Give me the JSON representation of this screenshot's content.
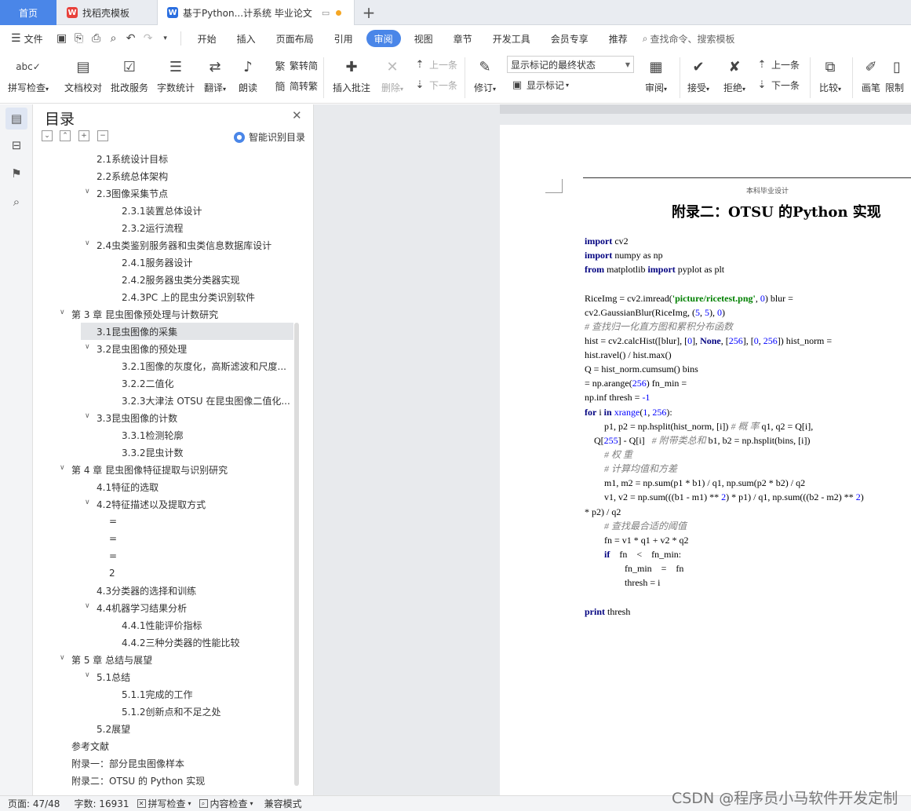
{
  "tabs": {
    "home": "首页",
    "templates": "找稻壳模板",
    "document": "基于Python...计系统 毕业论文",
    "new_tab": "+",
    "templates_icon": "W",
    "document_icon": "W"
  },
  "menu": {
    "file": "文件",
    "items": [
      "开始",
      "插入",
      "页面布局",
      "引用",
      "审阅",
      "视图",
      "章节",
      "开发工具",
      "会员专享",
      "推荐"
    ],
    "active": "审阅",
    "search": "查找命令、搜索模板"
  },
  "ribbon": {
    "spell_check": "拼写检查",
    "doc_proof": "文档校对",
    "batch_service": "批改服务",
    "word_count": "字数统计",
    "translate": "翻译",
    "read_aloud": "朗读",
    "trad_to_simp": "繁转简",
    "simp_to_trad": "简转繁",
    "insert_comment": "插入批注",
    "delete": "删除",
    "prev": "上一条",
    "next": "下一条",
    "revise": "修订",
    "markup_state": "显示标记的最终状态",
    "show_markup": "显示标记",
    "review": "审阅",
    "accept": "接受",
    "reject": "拒绝",
    "prev2": "上一条",
    "next2": "下一条",
    "compare": "比较",
    "brush": "画笔",
    "limit": "限制"
  },
  "toc": {
    "title": "目录",
    "smart": "智能识别目录",
    "items": [
      "2.1系统设计目标",
      "2.2系统总体架构",
      "2.3图像采集节点",
      "2.3.1装置总体设计",
      "2.3.2运行流程",
      "2.4虫类鉴别服务器和虫类信息数据库设计",
      "2.4.1服务器设计",
      "2.4.2服务器虫类分类器实现",
      "2.4.3PC 上的昆虫分类识别软件",
      "第 3 章 昆虫图像预处理与计数研究",
      "3.1昆虫图像的采集",
      "3.2昆虫图像的预处理",
      "3.2.1图像的灰度化，高斯滤波和尺度...",
      "3.2.2二值化",
      "3.2.3大津法 OTSU 在昆虫图像二值化...",
      "3.3昆虫图像的计数",
      "3.3.1检测轮廓",
      "3.3.2昆虫计数",
      "第 4 章 昆虫图像特征提取与识别研究",
      "4.1特征的选取",
      "4.2特征描述以及提取方式",
      "=",
      "=",
      "=",
      "2",
      "4.3分类器的选择和训练",
      "4.4机器学习结果分析",
      "4.4.1性能评价指标",
      "4.4.2三种分类器的性能比较",
      "第 5 章 总结与展望",
      "5.1总结",
      "5.1.1完成的工作",
      "5.1.2创新点和不足之处",
      "5.2展望",
      "参考文献",
      "附录一：部分昆虫图像样本",
      "附录二：OTSU 的 Python 实现"
    ]
  },
  "document": {
    "header": "本科毕业设计",
    "heading": "附录二：OTSU 的Python 实现",
    "code_lines": [
      "import cv2",
      "import numpy as np",
      "from matplotlib import pyplot as plt",
      "RiceImg = cv2.imread('picture/ricetest.png', 0) blur =",
      "cv2.GaussianBlur(RiceImg, (5, 5), 0)",
      "# 查找归一化直方图和累积分布函数",
      "hist = cv2.calcHist([blur], [0], None, [256], [0, 256]) hist_norm =",
      "hist.ravel() / hist.max()",
      "Q = hist_norm.cumsum() bins",
      "= np.arange(256) fn_min =",
      "np.inf thresh = -1",
      "for i in xrange(1, 256):",
      "p1, p2 = np.hsplit(hist_norm, [i]) # 概 率 q1, q2 = Q[i],",
      "Q[255] - Q[i]   # 附带类总和 b1, b2 = np.hsplit(bins, [i])",
      "# 权 重",
      "# 计算均值和方差",
      "m1, m2 = np.sum(p1 * b1) / q1, np.sum(p2 * b2) / q2",
      "v1, v2 = np.sum(((b1 - m1) ** 2) * p1) / q1, np.sum(((b2 - m2) ** 2)",
      "* p2) / q2",
      "# 查找最合适的阈值",
      "fn = v1 * q1 + v2 * q2",
      "if    fn    <    fn_min:",
      "fn_min    =    fn",
      "thresh = i",
      "print thresh"
    ]
  },
  "status": {
    "page": "页面: 47/48",
    "words": "字数: 16931",
    "spell": "拼写检查",
    "content": "内容检查",
    "compat": "兼容模式"
  },
  "watermark": "CSDN @程序员小马软件开发定制",
  "colors": {
    "accent": "#4a86e8",
    "keyword": "#000080",
    "string": "#008000",
    "number": "#0000ff",
    "comment": "#808080"
  }
}
